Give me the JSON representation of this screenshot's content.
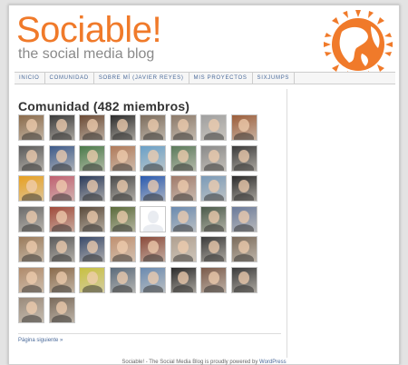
{
  "header": {
    "site_title": "Sociable!",
    "tagline": "the social media blog"
  },
  "nav": {
    "items": [
      "INICIO",
      "COMUNIDAD",
      "SOBRE MÍ (JAVIER REYES)",
      "MIS PROYECTOS",
      "SIXJUMPS"
    ]
  },
  "community": {
    "title": "Comunidad (482 miembros)",
    "avatars": [
      {
        "style": "photo",
        "color": "#8a6a4a"
      },
      {
        "style": "photo",
        "color": "#3a3a3a"
      },
      {
        "style": "photo",
        "color": "#6b4a34"
      },
      {
        "style": "photo",
        "color": "#2b2b2b"
      },
      {
        "style": "photo",
        "color": "#7c6c5c"
      },
      {
        "style": "photo",
        "color": "#8c7a6a"
      },
      {
        "style": "photo",
        "color": "#a0a0a0"
      },
      {
        "style": "photo",
        "color": "#9b5d3a"
      },
      {
        "style": "photo",
        "color": "#5a5a5a"
      },
      {
        "style": "photo",
        "color": "#3d5a8a"
      },
      {
        "style": "photo",
        "color": "#4a7a4a"
      },
      {
        "style": "photo",
        "color": "#b07a5a"
      },
      {
        "style": "photo",
        "color": "#6aa0c8"
      },
      {
        "style": "photo",
        "color": "#5b7a5b"
      },
      {
        "style": "photo",
        "color": "#8a8a8a"
      },
      {
        "style": "photo",
        "color": "#3a3a3a"
      },
      {
        "style": "photo",
        "color": "#e8a020"
      },
      {
        "style": "photo",
        "color": "#c06070"
      },
      {
        "style": "photo",
        "color": "#2a3a5a"
      },
      {
        "style": "photo",
        "color": "#4a4a4a"
      },
      {
        "style": "photo",
        "color": "#2a5ab0"
      },
      {
        "style": "photo",
        "color": "#a07a6a"
      },
      {
        "style": "photo",
        "color": "#7a9ab8"
      },
      {
        "style": "photo",
        "color": "#2a2a2a"
      },
      {
        "style": "photo",
        "color": "#6a6a6a"
      },
      {
        "style": "photo",
        "color": "#a04a3a"
      },
      {
        "style": "photo",
        "color": "#5a4a3a"
      },
      {
        "style": "photo",
        "color": "#5a6a3a"
      },
      {
        "style": "blank",
        "color": "#e9ecf1"
      },
      {
        "style": "photo",
        "color": "#6a8ab0"
      },
      {
        "style": "photo",
        "color": "#4a5a4a"
      },
      {
        "style": "photo",
        "color": "#6a7a9a"
      },
      {
        "style": "photo",
        "color": "#9a7a5a"
      },
      {
        "style": "photo",
        "color": "#5a5a5a"
      },
      {
        "style": "photo",
        "color": "#3a4a6a"
      },
      {
        "style": "photo",
        "color": "#c09070"
      },
      {
        "style": "photo",
        "color": "#8a4a3a"
      },
      {
        "style": "photo",
        "color": "#b0a090"
      },
      {
        "style": "photo",
        "color": "#3a3a3a"
      },
      {
        "style": "photo",
        "color": "#7a6a5a"
      },
      {
        "style": "photo",
        "color": "#b08a6a"
      },
      {
        "style": "photo",
        "color": "#8a6a4a"
      },
      {
        "style": "photo",
        "color": "#c8c040"
      },
      {
        "style": "photo",
        "color": "#5a6a7a"
      },
      {
        "style": "photo",
        "color": "#6a8ab0"
      },
      {
        "style": "photo",
        "color": "#2a2a2a"
      },
      {
        "style": "photo",
        "color": "#7a5a4a"
      },
      {
        "style": "photo",
        "color": "#3a3a3a"
      },
      {
        "style": "photo",
        "color": "#9a8a7a"
      },
      {
        "style": "photo",
        "color": "#7a6a5a"
      }
    ]
  },
  "pagination": {
    "next_label": "Página siguiente »"
  },
  "footer": {
    "text": "Sociable! - The Social Media Blog is proudly powered by",
    "link": "WordPress"
  },
  "colors": {
    "accent": "#f07a2a",
    "link": "#4a6a9a"
  }
}
